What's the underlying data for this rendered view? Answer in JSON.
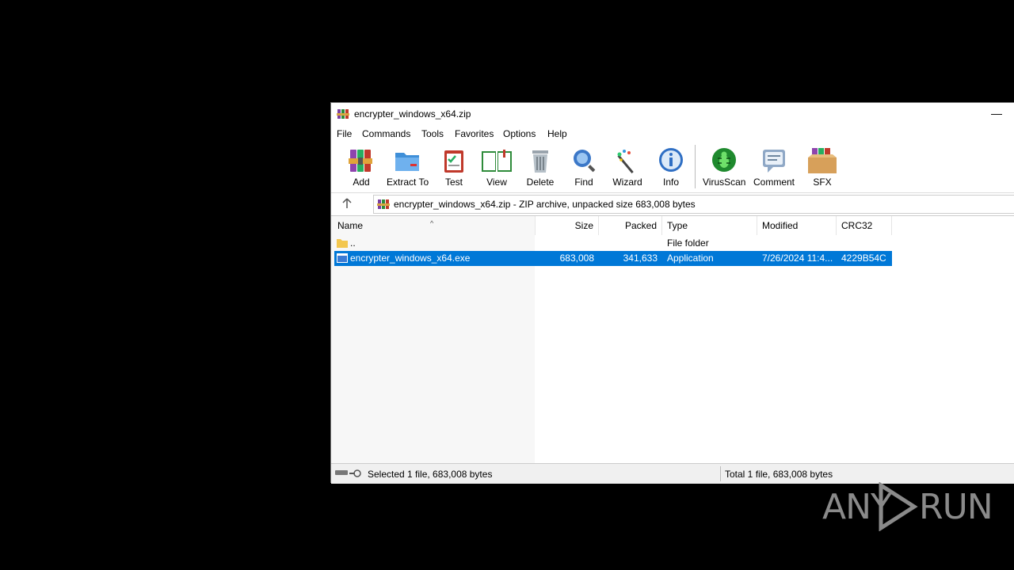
{
  "window": {
    "title": "encrypter_windows_x64.zip",
    "minimize_glyph": "—"
  },
  "menu": [
    "File",
    "Commands",
    "Tools",
    "Favorites",
    "Options",
    "Help"
  ],
  "toolbar": [
    {
      "label": "Add",
      "icon": "add-archive-icon"
    },
    {
      "label": "Extract To",
      "icon": "extract-folder-icon"
    },
    {
      "label": "Test",
      "icon": "test-clipboard-icon"
    },
    {
      "label": "View",
      "icon": "view-book-icon"
    },
    {
      "label": "Delete",
      "icon": "trash-icon"
    },
    {
      "label": "Find",
      "icon": "magnifier-icon"
    },
    {
      "label": "Wizard",
      "icon": "wand-icon"
    },
    {
      "label": "Info",
      "icon": "info-icon"
    },
    {
      "label": "VirusScan",
      "icon": "bug-scan-icon"
    },
    {
      "label": "Comment",
      "icon": "comment-icon"
    },
    {
      "label": "SFX",
      "icon": "sfx-box-icon"
    }
  ],
  "address": {
    "text": "encrypter_windows_x64.zip - ZIP archive, unpacked size 683,008 bytes",
    "up_glyph": "🡡"
  },
  "columns": [
    "Name",
    "Size",
    "Packed",
    "Type",
    "Modified",
    "CRC32"
  ],
  "sort_indicator": "^",
  "rows": [
    {
      "name": "..",
      "size": "",
      "packed": "",
      "type": "File folder",
      "modified": "",
      "crc": "",
      "selected": false,
      "icon": "folder-icon"
    },
    {
      "name": "encrypter_windows_x64.exe",
      "size": "683,008",
      "packed": "341,633",
      "type": "Application",
      "modified": "7/26/2024 11:4...",
      "crc": "4229B54C",
      "selected": true,
      "icon": "exe-icon"
    }
  ],
  "status": {
    "left": "Selected 1 file, 683,008 bytes",
    "right": "Total 1 file, 683,008 bytes"
  },
  "watermark": {
    "left": "ANY",
    "right": "RUN"
  },
  "colors": {
    "selection": "#0078d7",
    "background": "#000000"
  }
}
